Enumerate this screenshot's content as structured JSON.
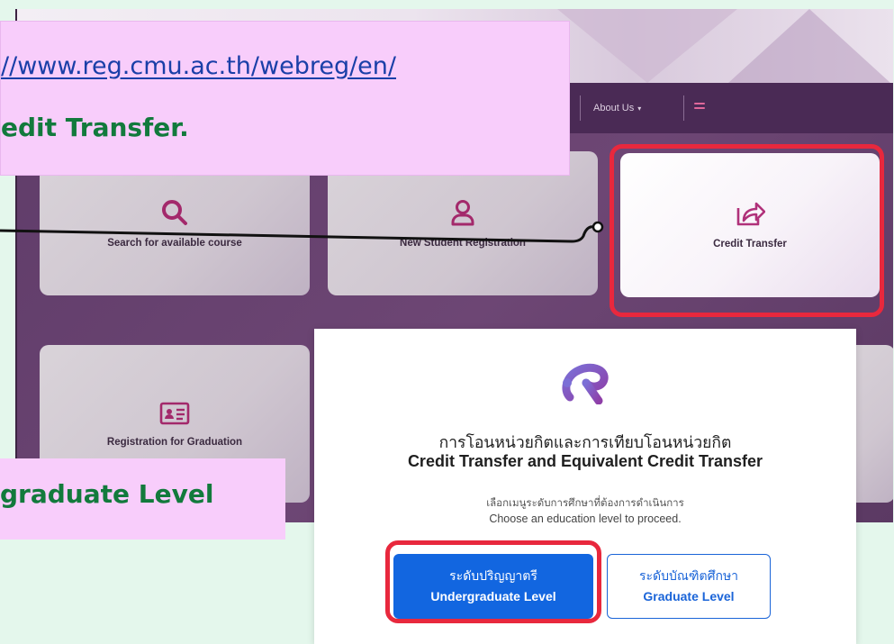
{
  "website": {
    "nav": {
      "about_label": "About Us"
    },
    "cards": [
      {
        "label": "Search for available course",
        "icon": "search-icon"
      },
      {
        "label": "New Student Registration",
        "icon": "user-icon"
      },
      {
        "label": "Credit Transfer",
        "icon": "share-arrow-icon"
      },
      {
        "label": "Registration for Graduation",
        "icon": "id-card-icon"
      }
    ]
  },
  "annotations": {
    "url_text": "//www.reg.cmu.ac.th/webreg/en/",
    "step_title": "edit Transfer.",
    "level_note": "graduate Level"
  },
  "modal": {
    "logo_icon": "cmu-reg-logo-icon",
    "title_th": "การโอนหน่วยกิตและการเทียบโอนหน่วยกิต",
    "title_en": "Credit Transfer and Equivalent Credit Transfer",
    "subtitle_th": "เลือกเมนูระดับการศึกษาที่ต้องการดำเนินการ",
    "subtitle_en": "Choose an education level to proceed.",
    "buttons": [
      {
        "label_th": "ระดับปริญญาตรี",
        "label_en": "Undergraduate Level"
      },
      {
        "label_th": "ระดับบัณฑิตศึกษา",
        "label_en": "Graduate Level"
      }
    ]
  },
  "colors": {
    "annotation_bg": "#f8cdfb",
    "annotation_text": "#127a3c",
    "highlight": "#e8283d",
    "primary_button": "#1266e0",
    "site_purple": "#5e3b68",
    "page_bg": "#e4f7ec"
  }
}
